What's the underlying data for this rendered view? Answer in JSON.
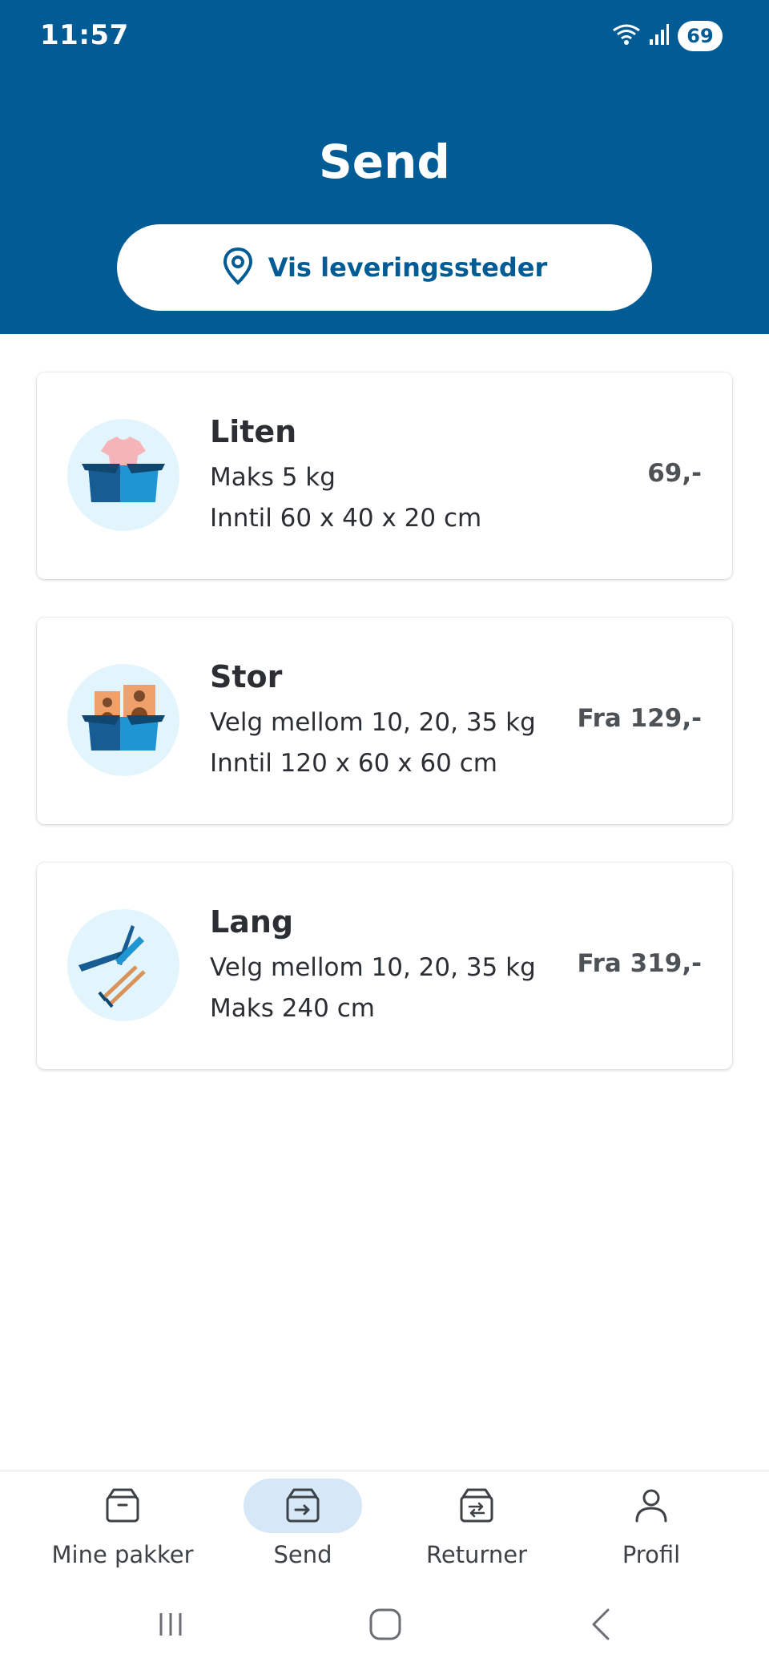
{
  "status_bar": {
    "time": "11:57",
    "battery": "69",
    "icons": [
      "wifi-icon",
      "signal-icon",
      "battery-icon"
    ]
  },
  "header": {
    "title": "Send",
    "location_button_label": "Vis leveringssteder",
    "background_color": "#015b95"
  },
  "packages": [
    {
      "title": "Liten",
      "line1": "Maks 5 kg",
      "line2": "Inntil 60 x 40 x 20 cm",
      "price": "69,-",
      "icon": "tshirt-box-icon"
    },
    {
      "title": "Stor",
      "line1": "Velg mellom 10, 20, 35 kg",
      "line2": "Inntil 120 x 60 x 60 cm",
      "price": "Fra 129,-",
      "icon": "speakers-box-icon"
    },
    {
      "title": "Lang",
      "line1": "Velg mellom 10, 20, 35 kg",
      "line2": "Maks 240 cm",
      "price": "Fra 319,-",
      "icon": "tools-skis-icon"
    }
  ],
  "bottom_nav": {
    "items": [
      {
        "label": "Mine pakker",
        "icon": "package-icon",
        "active": false
      },
      {
        "label": "Send",
        "icon": "package-send-icon",
        "active": true
      },
      {
        "label": "Returner",
        "icon": "package-return-icon",
        "active": false
      },
      {
        "label": "Profil",
        "icon": "person-icon",
        "active": false
      }
    ]
  },
  "colors": {
    "brand_blue": "#015b95",
    "active_nav_bg": "#d6e7f7",
    "icon_bg": "#e3f5fc"
  }
}
